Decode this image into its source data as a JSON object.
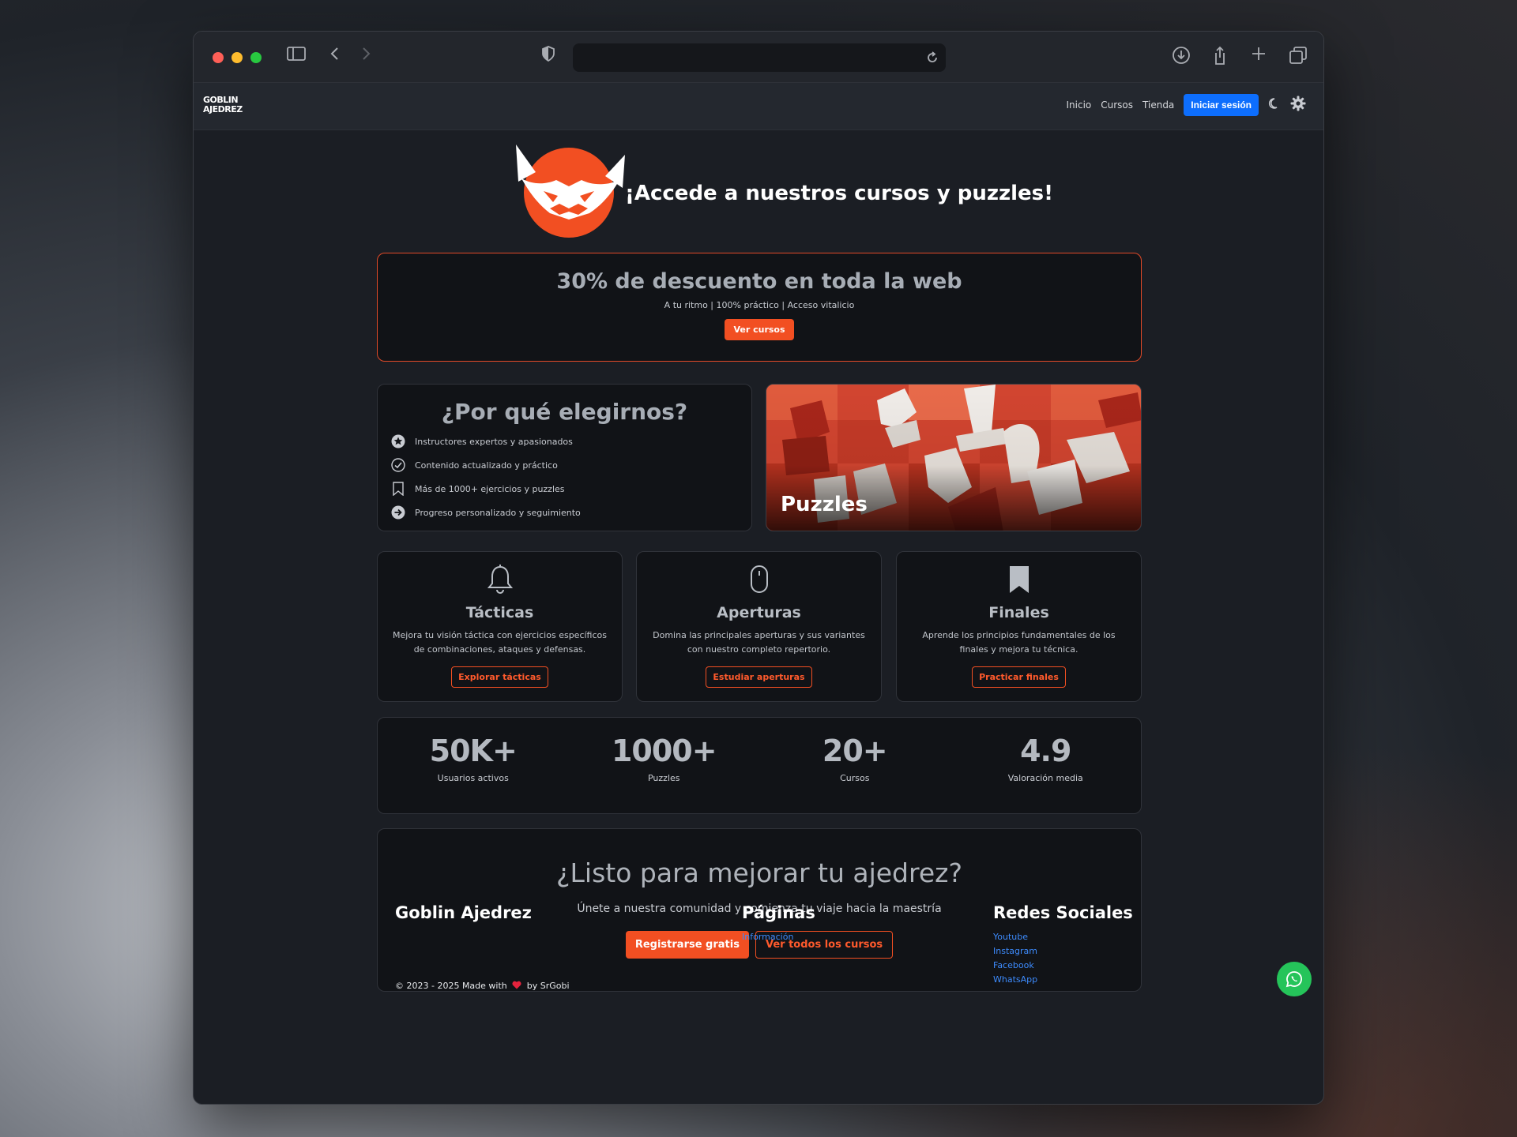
{
  "colors": {
    "accent": "#f24f22",
    "primary_blue": "#0d6efd",
    "link_blue": "#3d8bfd",
    "whatsapp": "#25c45a"
  },
  "browser": {
    "icons": [
      "sidebar-icon",
      "back-icon",
      "forward-icon",
      "shield-icon",
      "reload-icon",
      "download-icon",
      "share-icon",
      "new-tab-icon",
      "tabs-overview-icon"
    ]
  },
  "nav": {
    "logo_line1": "GOBLIN",
    "logo_line2": "AJEDREZ",
    "links": [
      "Inicio",
      "Cursos",
      "Tienda"
    ],
    "login": "Iniciar sesión"
  },
  "hero": {
    "title": "¡Accede a nuestros cursos y puzzles!"
  },
  "promo": {
    "title": "30% de descuento en toda la web",
    "subtitle": "A tu ritmo | 100% práctico | Acceso vitalicio",
    "button": "Ver cursos"
  },
  "why": {
    "title": "¿Por qué elegirnos?",
    "items": [
      "Instructores expertos y apasionados",
      "Contenido actualizado y práctico",
      "Más de 1000+ ejercicios y puzzles",
      "Progreso personalizado y seguimiento"
    ]
  },
  "puzzles": {
    "title": "Puzzles"
  },
  "features": [
    {
      "title": "Tácticas",
      "desc": "Mejora tu visión táctica con ejercicios específicos de combinaciones, ataques y defensas.",
      "button": "Explorar tácticas"
    },
    {
      "title": "Aperturas",
      "desc": "Domina las principales aperturas y sus variantes con nuestro completo repertorio.",
      "button": "Estudiar aperturas"
    },
    {
      "title": "Finales",
      "desc": "Aprende los principios fundamentales de los finales y mejora tu técnica.",
      "button": "Practicar finales"
    }
  ],
  "stats": [
    {
      "num": "50K+",
      "label": "Usuarios activos"
    },
    {
      "num": "1000+",
      "label": "Puzzles"
    },
    {
      "num": "20+",
      "label": "Cursos"
    },
    {
      "num": "4.9",
      "label": "Valoración media"
    }
  ],
  "cta": {
    "title": "¿Listo para mejorar tu ajedrez?",
    "subtitle": "Únete a nuestra comunidad y comienza tu viaje hacia la maestría",
    "primary": "Registrarse gratis",
    "secondary": "Ver todos los cursos"
  },
  "footer": {
    "brand": "Goblin Ajedrez",
    "pages_title": "Páginas",
    "pages": [
      "Información"
    ],
    "social_title": "Redes Sociales",
    "social": [
      "Youtube",
      "Instagram",
      "Facebook",
      "WhatsApp"
    ],
    "copyright_pre": "© 2023 - 2025 Made with",
    "copyright_post": "by SrGobi"
  }
}
